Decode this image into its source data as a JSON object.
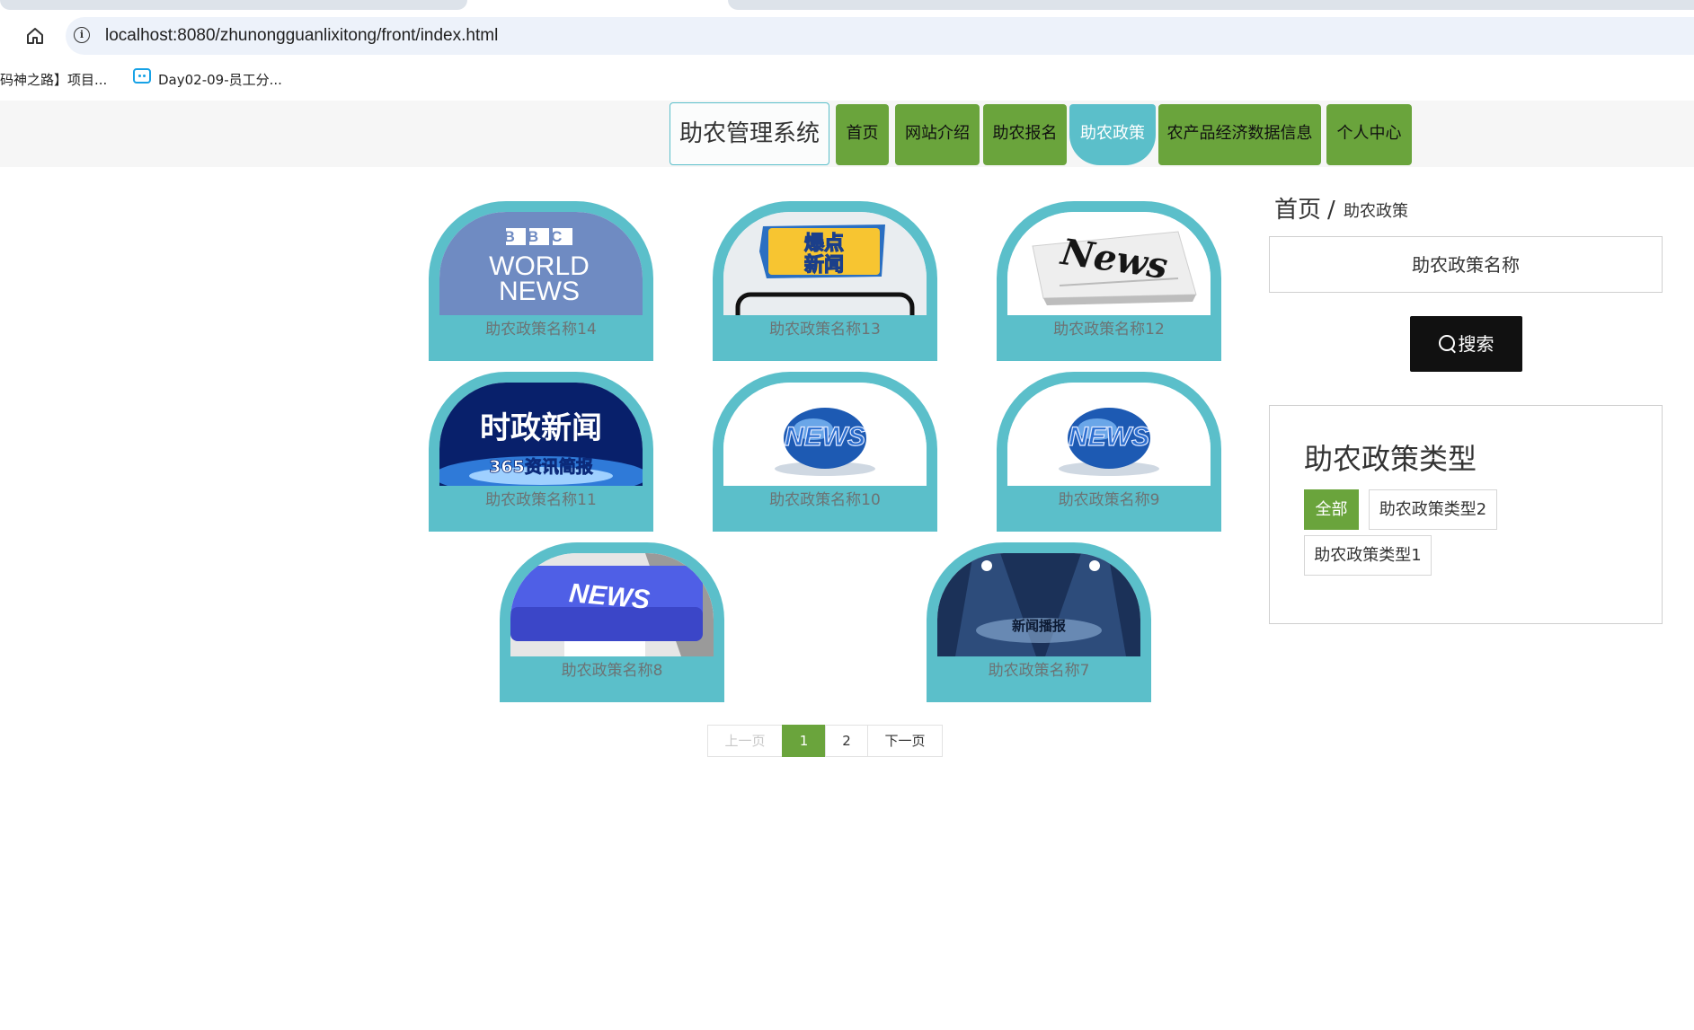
{
  "browser": {
    "url": "localhost:8080/zhunongguanlixitong/front/index.html",
    "bookmarks": [
      "码神之路】项目...",
      "Day02-09-员工分..."
    ]
  },
  "nav": {
    "brand": "助农管理系统",
    "items": [
      "首页",
      "网站介绍",
      "助农报名",
      "助农政策",
      "农产品经济数据信息",
      "个人中心"
    ],
    "active": "助农政策"
  },
  "cards": [
    {
      "title": "助农政策名称14",
      "image": "BBC WORLD NEWS logo"
    },
    {
      "title": "助农政策名称13",
      "image": "爆点新闻 phone banner"
    },
    {
      "title": "助农政策名称12",
      "image": "News newspaper"
    },
    {
      "title": "助农政策名称11",
      "image": "时政新闻 365资讯简报 banner"
    },
    {
      "title": "助农政策名称10",
      "image": "NEWS globe"
    },
    {
      "title": "助农政策名称9",
      "image": "NEWS globe"
    },
    {
      "title": "助农政策名称8",
      "image": "NEWS keyboard key"
    },
    {
      "title": "助农政策名称7",
      "image": "新闻播报 stage"
    }
  ],
  "card_image_text": {
    "bbc": [
      "BBC",
      "WORLD",
      "NEWS"
    ],
    "baodian": [
      "爆点",
      "新闻"
    ],
    "newspaper": "News",
    "shizheng": [
      "时政新闻",
      "365资讯简报"
    ],
    "globe": "NEWS",
    "key": "NEWS",
    "stage": "新闻播报"
  },
  "pagination": {
    "prev": "上一页",
    "pages": [
      "1",
      "2"
    ],
    "current": "1",
    "next": "下一页"
  },
  "sidebar": {
    "breadcrumb_home": "首页",
    "breadcrumb_sep": "/",
    "breadcrumb_current": "助农政策",
    "search_placeholder": "助农政策名称",
    "search_button": "搜索",
    "type_title": "助农政策类型",
    "types": [
      "全部",
      "助农政策类型2",
      "助农政策类型1"
    ],
    "active_type": "全部"
  },
  "colors": {
    "teal": "#5bbfca",
    "green": "#6aa43c",
    "black": "#111111"
  }
}
